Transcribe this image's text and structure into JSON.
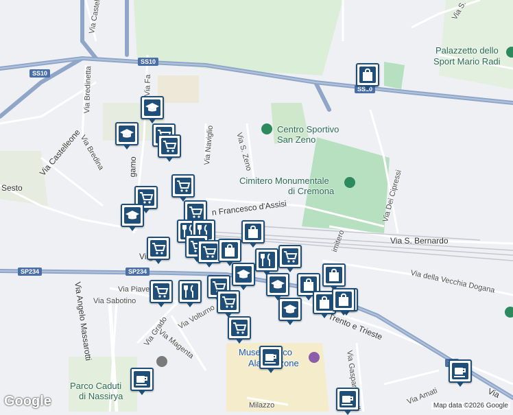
{
  "map": {
    "attribution": "Map data ©2026 Google",
    "logo": "Google",
    "colors": {
      "road": "#ffffff",
      "highway": "#8fa6c8",
      "park": "#b7e0c0",
      "pin": "#1f4e79",
      "background": "#eef0f3"
    }
  },
  "labels": {
    "palazzetto_1": "Palazzetto dello",
    "palazzetto_2": "Sport Mario Radi",
    "centro_1": "Centro Sportivo",
    "centro_2": "San Zeno",
    "cimitero_1": "Cimitero Monumentale",
    "cimitero_2": "di Cremona",
    "parco_1": "Parco Caduti",
    "parco_2": "di Nassirya",
    "museo_1": "Museo Civico",
    "museo_2": "Ala Ponzone",
    "via_castelverde": "Via Castelverde",
    "via_bredinetta": "Via Bredinetta",
    "via_bredina": "Via Bredina",
    "via_castelleone": "Via Castelleone",
    "sesto": "Sesto",
    "via_fa": "Via Fa",
    "bergamo": "gamo",
    "via_naviglio": "Via Naviglio",
    "via_s_zeno": "Via S. Zeno",
    "via_s_francesco": "n Francesco d'Assisi",
    "via_dei_cipressi": "Via Dei Cipressi",
    "via_s_bernardo": "Via S. Bernardo",
    "via_vecchia_dogana": "Via della Vecchia Dogana",
    "via_massarotti": "Via Angelo Massarotti",
    "via_piave": "Via Piave",
    "via_sabotino": "Via Sabotino",
    "via_volturno": "Via Volturno",
    "via_grado": "Via Grado",
    "via_magenta": "Via Magenta",
    "trento_trieste": "Trento e Trieste",
    "via_aselli": "Via Gaspare Aselli",
    "via_amati": "Via Amati",
    "milazzo": "Milazzo",
    "via_ga": "Via",
    "vigan": "Vi gan",
    "cimitero_road": "imitero",
    "via_s_g": "Via S. G",
    "ss10_a": "SS10",
    "ss10_b": "SS10",
    "ss10_c": "SS10",
    "sp234_a": "SP234",
    "sp234_b": "SP234",
    "sp_right": "SP"
  },
  "markers": [
    {
      "icon": "graduation-cap-icon"
    },
    {
      "icon": "graduation-cap-icon"
    },
    {
      "icon": "shopping-cart-icon"
    },
    {
      "icon": "shopping-cart-icon"
    },
    {
      "icon": "shopping-cart-icon"
    },
    {
      "icon": "shopping-cart-icon"
    },
    {
      "icon": "graduation-cap-icon"
    },
    {
      "icon": "shopping-cart-icon"
    },
    {
      "icon": "restaurant-icon"
    },
    {
      "icon": "restaurant-icon"
    },
    {
      "icon": "shopping-cart-icon"
    },
    {
      "icon": "shopping-cart-icon"
    },
    {
      "icon": "shopping-bag-icon"
    },
    {
      "icon": "shopping-bag-icon"
    },
    {
      "icon": "restaurant-icon"
    },
    {
      "icon": "shopping-cart-icon"
    },
    {
      "icon": "graduation-cap-icon"
    },
    {
      "icon": "shopping-cart-icon"
    },
    {
      "icon": "restaurant-icon"
    },
    {
      "icon": "shopping-cart-icon"
    },
    {
      "icon": "shopping-cart-icon"
    },
    {
      "icon": "shopping-bag-icon"
    },
    {
      "icon": "shopping-cart-icon"
    },
    {
      "icon": "graduation-cap-icon"
    },
    {
      "icon": "shopping-bag-icon"
    },
    {
      "icon": "graduation-cap-icon"
    },
    {
      "icon": "shopping-bag-icon"
    },
    {
      "icon": "shopping-bag-icon"
    },
    {
      "icon": "graduation-cap-icon"
    },
    {
      "icon": "coffee-cup-icon"
    },
    {
      "icon": "coffee-cup-icon"
    },
    {
      "icon": "coffee-cup-icon"
    },
    {
      "icon": "coffee-cup-icon"
    },
    {
      "icon": "shopping-bag-icon"
    },
    {
      "icon": "shopping-cart-icon"
    }
  ]
}
